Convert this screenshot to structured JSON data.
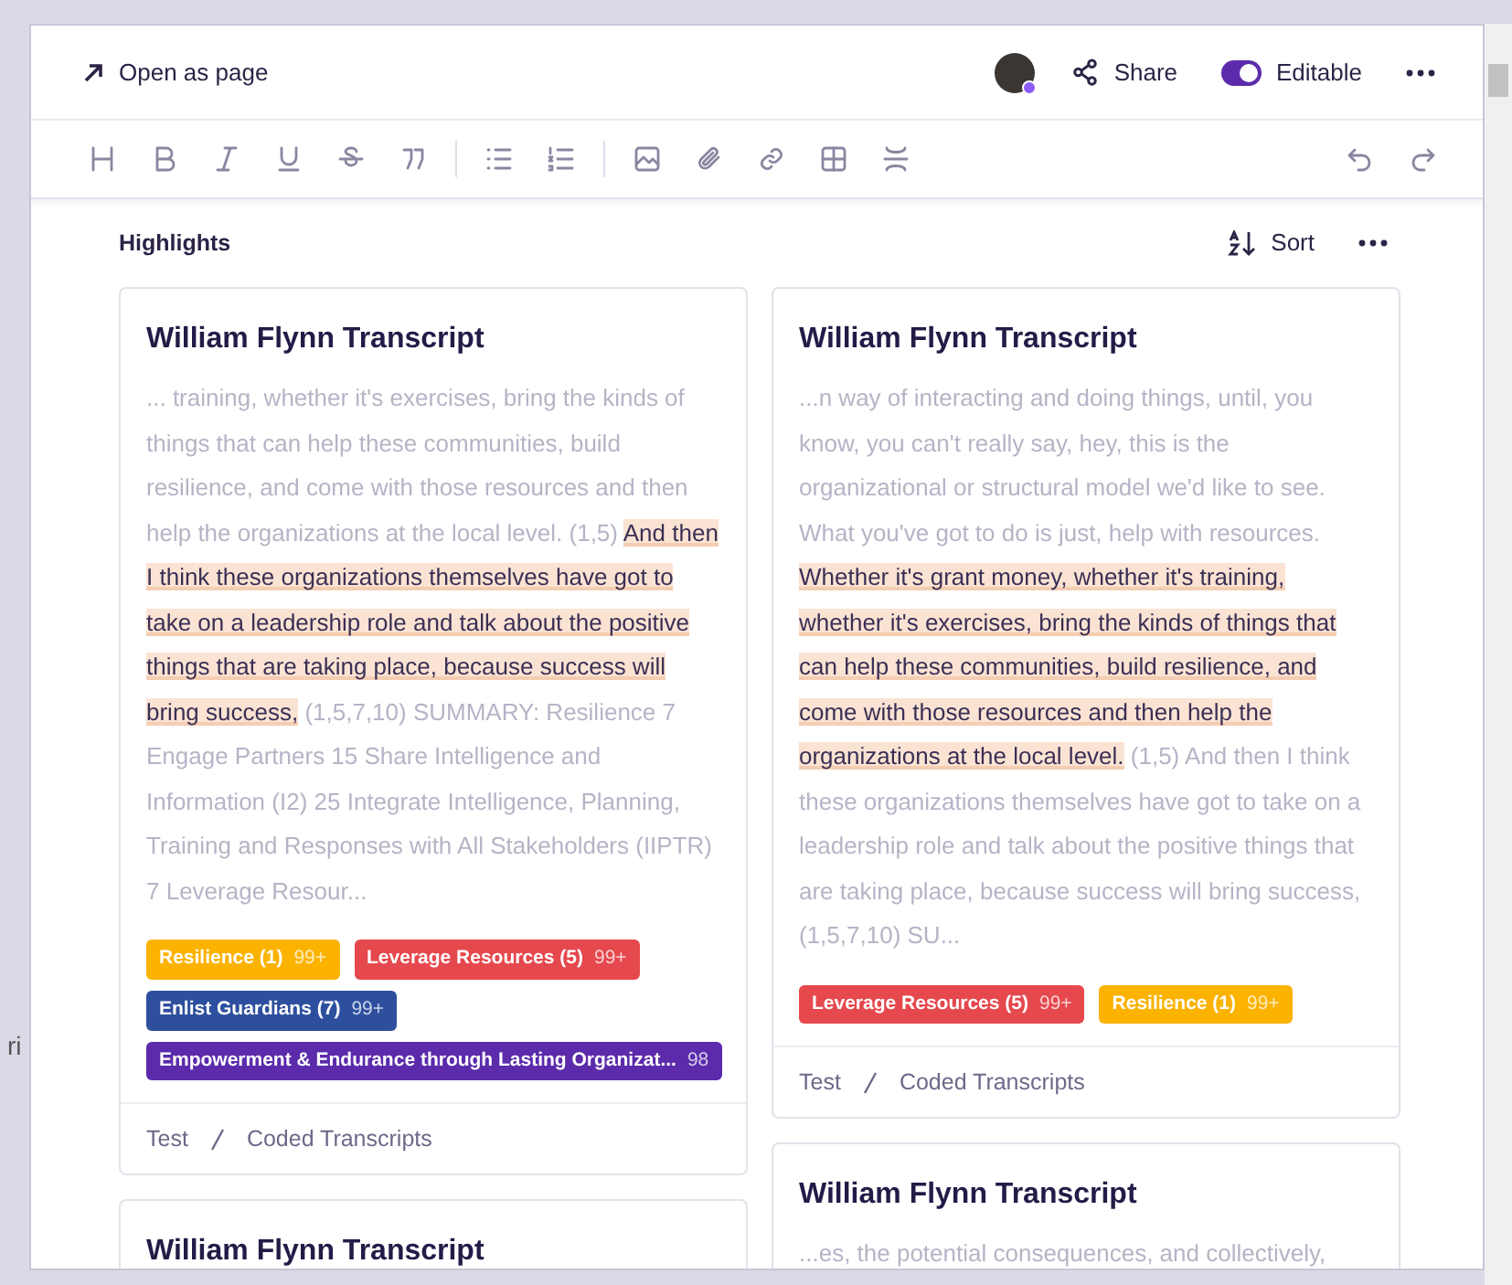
{
  "background_text": "ri",
  "header": {
    "open_link": "Open as page",
    "share": "Share",
    "editable": {
      "label": "Editable",
      "on": true
    }
  },
  "section": {
    "title": "Highlights",
    "sort": "Sort"
  },
  "columns": [
    {
      "cards": [
        {
          "title": "William Flynn Transcript",
          "segments": [
            {
              "text": "... training, whether it's exercises, bring the kinds of things that can help these communities, build resilience, and come with those resources and then help the organizations at the local level. (1,5) ",
              "highlighted": false
            },
            {
              "text": "And then I think these organizations themselves have got to take on a leadership role and talk about the positive things that are taking place, because success will bring success,",
              "highlighted": true
            },
            {
              "text": " (1,5,7,10) SUMMARY: Resilience 7 Engage Partners 15 Share Intelligence and Information (I2) 25 Integrate Intelligence, Planning, Training and Responses with All Stakeholders (IIPTR) 7 Leverage Resour...",
              "highlighted": false
            }
          ],
          "tags": [
            {
              "label": "Resilience (1)",
              "count": "99+",
              "color": "#fbb300"
            },
            {
              "label": "Leverage Resources (5)",
              "count": "99+",
              "color": "#e5484d"
            },
            {
              "label": "Enlist Guardians (7)",
              "count": "99+",
              "color": "#2d4f9e"
            },
            {
              "label": "Empowerment & Endurance through Lasting Organizat...",
              "count": "98",
              "color": "#5b2bab"
            }
          ],
          "breadcrumb": [
            "Test",
            "Coded Transcripts"
          ]
        },
        {
          "title": "William Flynn Transcript"
        }
      ]
    },
    {
      "cards": [
        {
          "title": "William Flynn Transcript",
          "segments": [
            {
              "text": "...n way of interacting and doing things, until, you know, you can't really say, hey, this is the organizational or structural model we'd like to see. What you've got to do is just, help with resources. ",
              "highlighted": false
            },
            {
              "text": "Whether it's grant money, whether it's training, whether it's exercises, bring the kinds of things that can help these communities, build resilience, and come with those resources and then help the organizations at the local level.",
              "highlighted": true
            },
            {
              "text": " (1,5) And then I think these organizations themselves have got to take on a leadership role and talk about the positive things that are taking place, because success will bring success, (1,5,7,10) SU...",
              "highlighted": false
            }
          ],
          "tags": [
            {
              "label": "Leverage Resources (5)",
              "count": "99+",
              "color": "#e5484d"
            },
            {
              "label": "Resilience (1)",
              "count": "99+",
              "color": "#fbb300"
            }
          ],
          "breadcrumb": [
            "Test",
            "Coded Transcripts"
          ]
        },
        {
          "title": "William Flynn Transcript",
          "segments": [
            {
              "text": "...es, the potential consequences, and collectively,",
              "highlighted": false
            }
          ]
        }
      ]
    }
  ]
}
